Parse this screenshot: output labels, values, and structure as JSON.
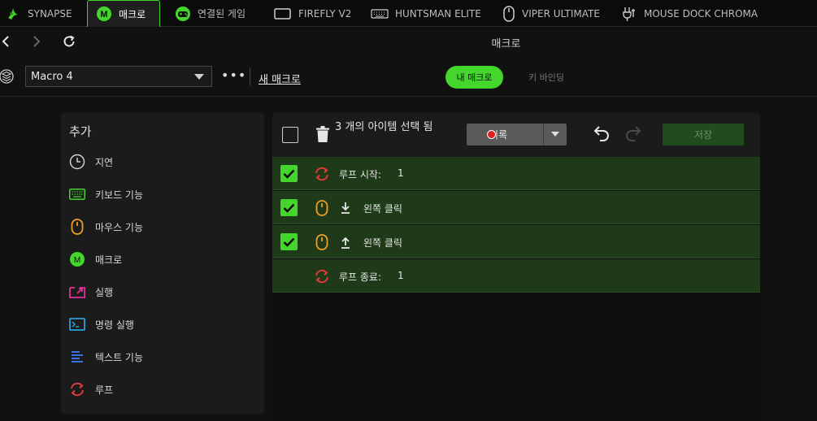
{
  "tabs": [
    {
      "label": "SYNAPSE",
      "icon": "razer-logo-icon"
    },
    {
      "label": "매크로",
      "icon": "macro-m-icon",
      "active": true
    },
    {
      "label": "연결된 게임",
      "icon": "gamepad-icon"
    },
    {
      "label": "FIREFLY V2",
      "icon": "mousepad-icon"
    },
    {
      "label": "HUNTSMAN ELITE",
      "icon": "keyboard-icon"
    },
    {
      "label": "VIPER ULTIMATE",
      "icon": "mouse-icon"
    },
    {
      "label": "MOUSE DOCK CHROMA",
      "icon": "mouse-dock-icon"
    }
  ],
  "nav": {
    "title": "매크로"
  },
  "macro_bar": {
    "selected_macro": "Macro 4",
    "more": "•••",
    "new_macro": "새 매크로",
    "my_macros": "내 매크로",
    "key_binding": "키 바인딩"
  },
  "add_panel": {
    "title": "추가",
    "items": [
      {
        "label": "지연",
        "icon": "clock-icon"
      },
      {
        "label": "키보드 기능",
        "icon": "keyboard-icon"
      },
      {
        "label": "마우스 기능",
        "icon": "mouse-icon"
      },
      {
        "label": "매크로",
        "icon": "macro-m-icon"
      },
      {
        "label": "실행",
        "icon": "launch-icon"
      },
      {
        "label": "명령 실행",
        "icon": "terminal-icon"
      },
      {
        "label": "텍스트 기능",
        "icon": "text-icon"
      },
      {
        "label": "루프",
        "icon": "loop-icon"
      }
    ]
  },
  "editor": {
    "selection_text": "3 개의 아이템 선택 됨",
    "record_label": "기록",
    "save_label": "저장",
    "rows": [
      {
        "checked": true,
        "icon": "loop-icon",
        "label": "루프 시작:",
        "value": "1"
      },
      {
        "checked": true,
        "icon": "mouse-icon",
        "arrow": "press-down",
        "label": "왼쪽 클릭"
      },
      {
        "checked": true,
        "icon": "mouse-icon",
        "arrow": "release-up",
        "label": "왼쪽 클릭"
      },
      {
        "checked": false,
        "icon": "loop-icon",
        "label": "루프 종료:",
        "value": "1"
      }
    ]
  },
  "colors": {
    "accent": "#44d62c",
    "row_bg": "#1e3a18",
    "loop": "#e03a3a",
    "mouse": "#f0a020",
    "launch": "#e0309a",
    "terminal": "#2aa0e0",
    "text_fn": "#3a70e0"
  }
}
